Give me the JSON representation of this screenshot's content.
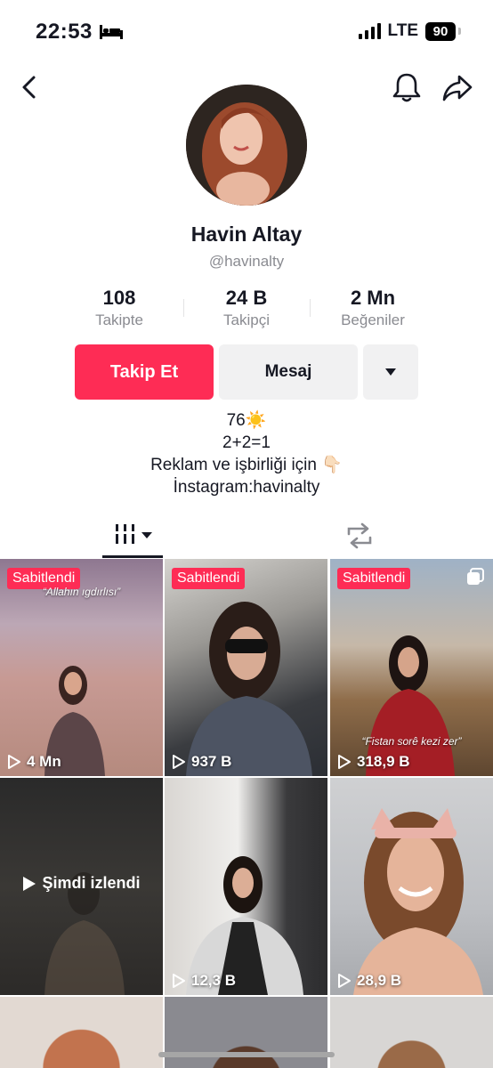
{
  "status_bar": {
    "time": "22:53",
    "network": "LTE",
    "battery": "90",
    "icons": [
      "bed-icon",
      "signal-icon",
      "battery-icon"
    ]
  },
  "nav": {
    "back_icon": "chevron-left-icon",
    "bell_icon": "bell-icon",
    "share_icon": "share-arrow-icon"
  },
  "profile": {
    "display_name": "Havin Altay",
    "username": "@havinalty",
    "stats": [
      {
        "value": "108",
        "label": "Takipte"
      },
      {
        "value": "24 B",
        "label": "Takipçi"
      },
      {
        "value": "2 Mn",
        "label": "Beğeniler"
      }
    ],
    "buttons": {
      "follow": "Takip Et",
      "message": "Mesaj",
      "more_icon": "caret-down-icon"
    },
    "bio": [
      "76☀️",
      "2+2=1",
      "Reklam ve işbirliği için 👇🏻",
      "İnstagram:havinalty"
    ]
  },
  "tabs": {
    "videos_icon": "grid-bars-icon",
    "reposts_icon": "repost-icon"
  },
  "videos": [
    {
      "pinned": "Sabitlendi",
      "caption": "“Allahın ıgdırlısı”",
      "views": "4 Mn",
      "multi": false
    },
    {
      "pinned": "Sabitlendi",
      "caption": "",
      "views": "937 B",
      "multi": false
    },
    {
      "pinned": "Sabitlendi",
      "caption": "“Fistan sorê kezi zer”",
      "views": "318,9 B",
      "multi": true
    },
    {
      "pinned": "",
      "caption": "",
      "views": "",
      "watched": "Şimdi izlendi",
      "multi": false
    },
    {
      "pinned": "",
      "caption": "",
      "views": "12,3 B",
      "multi": false
    },
    {
      "pinned": "",
      "caption": "",
      "views": "28,9 B",
      "multi": false
    }
  ],
  "colors": {
    "accent": "#fe2c55",
    "secondary_button": "#f1f1f2",
    "muted_text": "#8a8b91"
  }
}
